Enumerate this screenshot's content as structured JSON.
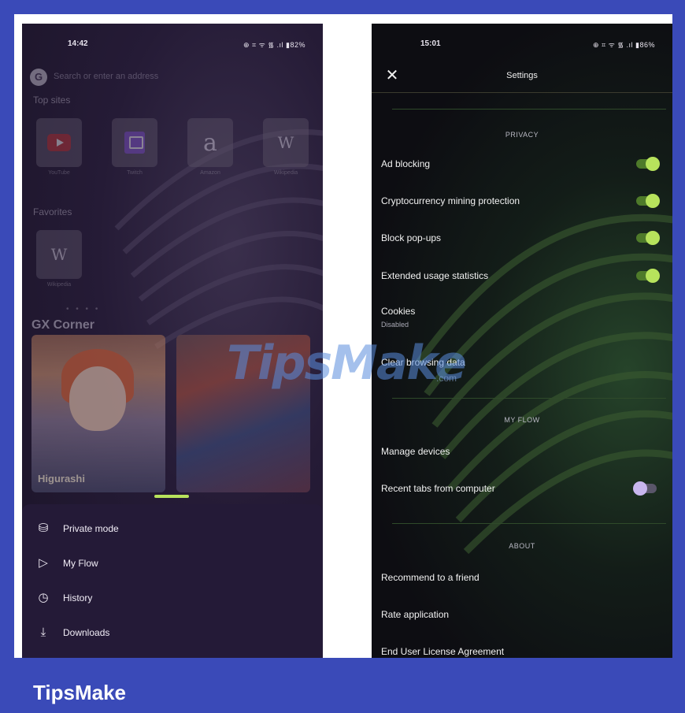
{
  "left_phone": {
    "status": {
      "time": "14:42",
      "icons": "⊕ ⌗ ᯤ ᯾ .ıl ▮82%"
    },
    "search_placeholder": "Search or enter an address",
    "top_sites_label": "Top sites",
    "top_sites": [
      {
        "name": "YouTube",
        "icon": "youtube-icon"
      },
      {
        "name": "Twitch",
        "icon": "twitch-icon"
      },
      {
        "name": "Amazon",
        "glyph": "a",
        "icon": "amazon-icon"
      },
      {
        "name": "Wikipedia",
        "glyph": "W",
        "icon": "wikipedia-icon"
      }
    ],
    "favorites_label": "Favorites",
    "favorites": [
      {
        "name": "Wikipedia",
        "glyph": "W"
      }
    ],
    "dots": "• • • •",
    "gx_corner_label": "GX Corner",
    "card_caption": "Higurashi",
    "menu": [
      {
        "label": "Private mode",
        "icon": "private-mode-icon",
        "glyph": "⛁"
      },
      {
        "label": "My Flow",
        "icon": "send-icon",
        "glyph": "▷"
      },
      {
        "label": "History",
        "icon": "clock-icon",
        "glyph": "◷"
      },
      {
        "label": "Downloads",
        "icon": "download-icon",
        "glyph": "⤓"
      }
    ]
  },
  "right_phone": {
    "status": {
      "time": "15:01",
      "icons": "⊕ ⌗ ᯤ ᯾ .ıl ▮86%"
    },
    "title": "Settings",
    "sections": {
      "privacy": "PRIVACY",
      "my_flow": "MY FLOW",
      "about": "ABOUT"
    },
    "privacy_rows": [
      {
        "label": "Ad blocking",
        "on": true
      },
      {
        "label": "Cryptocurrency mining protection",
        "on": true
      },
      {
        "label": "Block pop-ups",
        "on": true
      },
      {
        "label": "Extended usage statistics",
        "on": true
      }
    ],
    "cookies": {
      "label": "Cookies",
      "sub": "Disabled"
    },
    "clear_data": "Clear browsing data",
    "my_flow_rows": [
      {
        "label": "Manage devices"
      },
      {
        "label": "Recent tabs from computer",
        "on": false
      }
    ],
    "about_rows": [
      {
        "label": "Recommend to a friend"
      },
      {
        "label": "Rate application"
      },
      {
        "label": "End User License Agreement"
      }
    ]
  },
  "watermark": {
    "text": "TipsMake",
    "suffix": ".com"
  },
  "footer_brand": "TipsMake",
  "colors": {
    "background": "#3a4ab8",
    "accent_green": "#b7e35c",
    "toggle_off_knob": "#c8b6ee",
    "menu_sheet": "#241a37"
  }
}
